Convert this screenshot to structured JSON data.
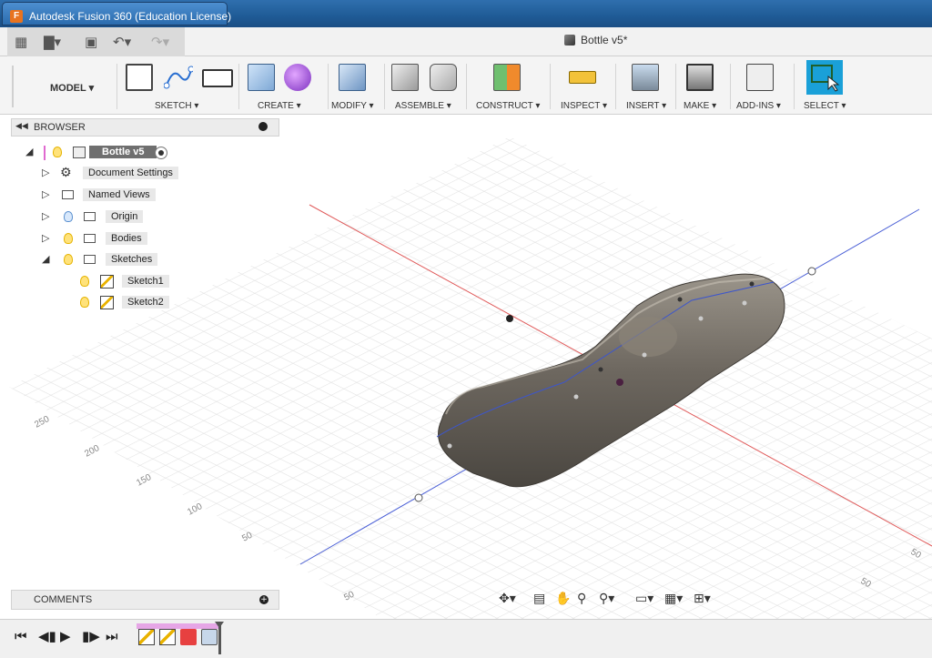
{
  "window": {
    "title": "Autodesk Fusion 360 (Education License)",
    "logo": "F"
  },
  "document": {
    "tab_label": "Bottle v5*"
  },
  "quick_access": {
    "icons": [
      "grid-icon",
      "file-icon",
      "save-icon",
      "undo-icon",
      "redo-icon"
    ]
  },
  "ribbon": {
    "workspace": "MODEL ▾",
    "groups": [
      {
        "label": "SKETCH ▾"
      },
      {
        "label": "CREATE ▾"
      },
      {
        "label": "MODIFY ▾"
      },
      {
        "label": "ASSEMBLE ▾"
      },
      {
        "label": "CONSTRUCT ▾"
      },
      {
        "label": "INSPECT ▾"
      },
      {
        "label": "INSERT ▾"
      },
      {
        "label": "MAKE ▾"
      },
      {
        "label": "ADD-INS ▾"
      },
      {
        "label": "SELECT ▾"
      }
    ]
  },
  "browser": {
    "header": "BROWSER",
    "root": "Bottle v5",
    "nodes": [
      "Document Settings",
      "Named Views",
      "Origin",
      "Bodies",
      "Sketches"
    ],
    "sketches": [
      "Sketch1",
      "Sketch2"
    ]
  },
  "viewport": {
    "grid_labels": [
      "250",
      "200",
      "150",
      "100",
      "50",
      "50",
      "50",
      "50"
    ]
  },
  "comments": {
    "label": "COMMENTS"
  },
  "colors": {
    "title_bar": "#1f5b96",
    "select_accent": "#1aa0d8",
    "x_axis": "#e05a5a",
    "z_axis": "#4a5fd6"
  }
}
